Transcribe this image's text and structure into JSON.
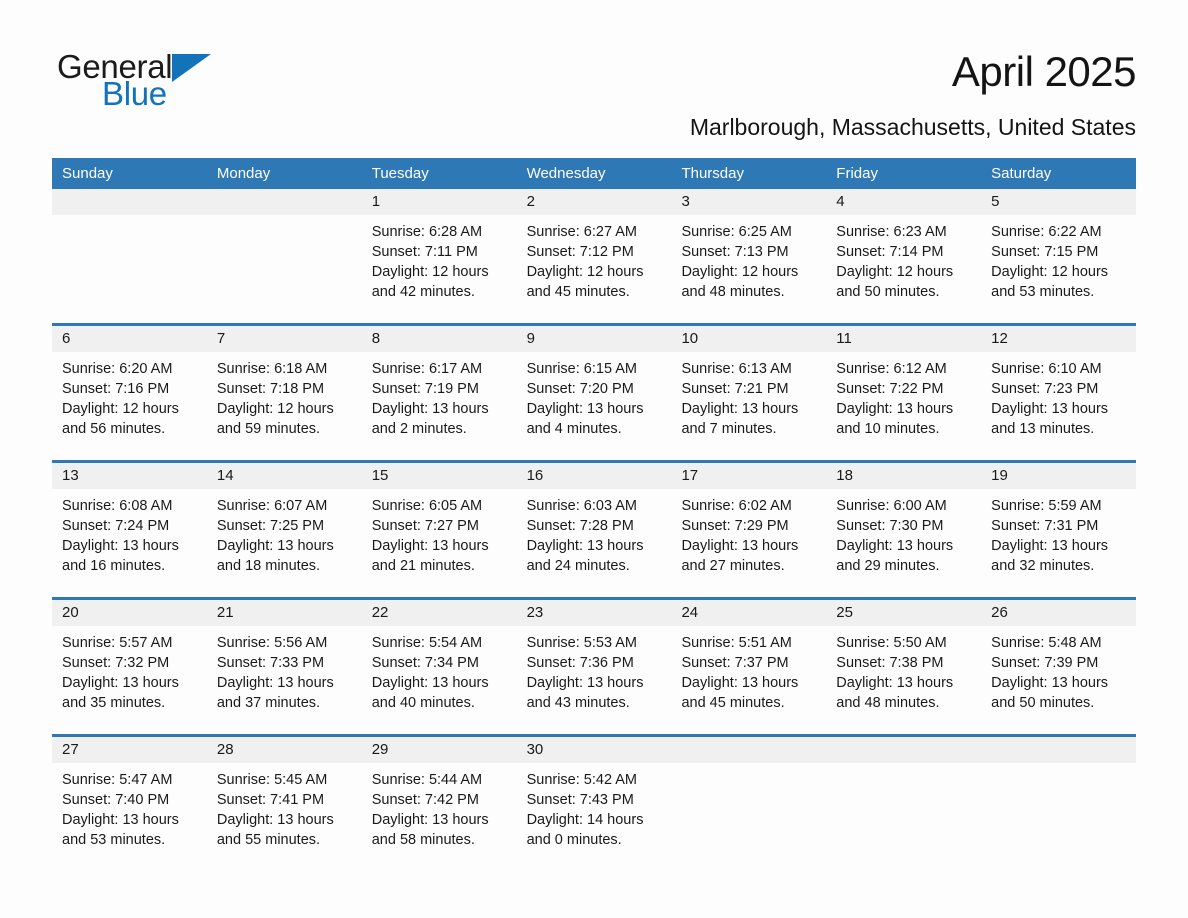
{
  "brand": {
    "name_part1": "General",
    "name_part2": "Blue",
    "accent_color": "#1273bb",
    "triangle_icon": "triangle-icon"
  },
  "header": {
    "title": "April 2025",
    "subtitle": "Marlborough, Massachusetts, United States"
  },
  "calendar": {
    "header_background": "#2f78b6",
    "daynumber_background": "#f0f0f0",
    "weekdays": [
      "Sunday",
      "Monday",
      "Tuesday",
      "Wednesday",
      "Thursday",
      "Friday",
      "Saturday"
    ],
    "weeks": [
      {
        "days": [
          {
            "number": "",
            "lines": []
          },
          {
            "number": "",
            "lines": []
          },
          {
            "number": "1",
            "lines": [
              "Sunrise: 6:28 AM",
              "Sunset: 7:11 PM",
              "Daylight: 12 hours",
              "and 42 minutes."
            ]
          },
          {
            "number": "2",
            "lines": [
              "Sunrise: 6:27 AM",
              "Sunset: 7:12 PM",
              "Daylight: 12 hours",
              "and 45 minutes."
            ]
          },
          {
            "number": "3",
            "lines": [
              "Sunrise: 6:25 AM",
              "Sunset: 7:13 PM",
              "Daylight: 12 hours",
              "and 48 minutes."
            ]
          },
          {
            "number": "4",
            "lines": [
              "Sunrise: 6:23 AM",
              "Sunset: 7:14 PM",
              "Daylight: 12 hours",
              "and 50 minutes."
            ]
          },
          {
            "number": "5",
            "lines": [
              "Sunrise: 6:22 AM",
              "Sunset: 7:15 PM",
              "Daylight: 12 hours",
              "and 53 minutes."
            ]
          }
        ]
      },
      {
        "days": [
          {
            "number": "6",
            "lines": [
              "Sunrise: 6:20 AM",
              "Sunset: 7:16 PM",
              "Daylight: 12 hours",
              "and 56 minutes."
            ]
          },
          {
            "number": "7",
            "lines": [
              "Sunrise: 6:18 AM",
              "Sunset: 7:18 PM",
              "Daylight: 12 hours",
              "and 59 minutes."
            ]
          },
          {
            "number": "8",
            "lines": [
              "Sunrise: 6:17 AM",
              "Sunset: 7:19 PM",
              "Daylight: 13 hours",
              "and 2 minutes."
            ]
          },
          {
            "number": "9",
            "lines": [
              "Sunrise: 6:15 AM",
              "Sunset: 7:20 PM",
              "Daylight: 13 hours",
              "and 4 minutes."
            ]
          },
          {
            "number": "10",
            "lines": [
              "Sunrise: 6:13 AM",
              "Sunset: 7:21 PM",
              "Daylight: 13 hours",
              "and 7 minutes."
            ]
          },
          {
            "number": "11",
            "lines": [
              "Sunrise: 6:12 AM",
              "Sunset: 7:22 PM",
              "Daylight: 13 hours",
              "and 10 minutes."
            ]
          },
          {
            "number": "12",
            "lines": [
              "Sunrise: 6:10 AM",
              "Sunset: 7:23 PM",
              "Daylight: 13 hours",
              "and 13 minutes."
            ]
          }
        ]
      },
      {
        "days": [
          {
            "number": "13",
            "lines": [
              "Sunrise: 6:08 AM",
              "Sunset: 7:24 PM",
              "Daylight: 13 hours",
              "and 16 minutes."
            ]
          },
          {
            "number": "14",
            "lines": [
              "Sunrise: 6:07 AM",
              "Sunset: 7:25 PM",
              "Daylight: 13 hours",
              "and 18 minutes."
            ]
          },
          {
            "number": "15",
            "lines": [
              "Sunrise: 6:05 AM",
              "Sunset: 7:27 PM",
              "Daylight: 13 hours",
              "and 21 minutes."
            ]
          },
          {
            "number": "16",
            "lines": [
              "Sunrise: 6:03 AM",
              "Sunset: 7:28 PM",
              "Daylight: 13 hours",
              "and 24 minutes."
            ]
          },
          {
            "number": "17",
            "lines": [
              "Sunrise: 6:02 AM",
              "Sunset: 7:29 PM",
              "Daylight: 13 hours",
              "and 27 minutes."
            ]
          },
          {
            "number": "18",
            "lines": [
              "Sunrise: 6:00 AM",
              "Sunset: 7:30 PM",
              "Daylight: 13 hours",
              "and 29 minutes."
            ]
          },
          {
            "number": "19",
            "lines": [
              "Sunrise: 5:59 AM",
              "Sunset: 7:31 PM",
              "Daylight: 13 hours",
              "and 32 minutes."
            ]
          }
        ]
      },
      {
        "days": [
          {
            "number": "20",
            "lines": [
              "Sunrise: 5:57 AM",
              "Sunset: 7:32 PM",
              "Daylight: 13 hours",
              "and 35 minutes."
            ]
          },
          {
            "number": "21",
            "lines": [
              "Sunrise: 5:56 AM",
              "Sunset: 7:33 PM",
              "Daylight: 13 hours",
              "and 37 minutes."
            ]
          },
          {
            "number": "22",
            "lines": [
              "Sunrise: 5:54 AM",
              "Sunset: 7:34 PM",
              "Daylight: 13 hours",
              "and 40 minutes."
            ]
          },
          {
            "number": "23",
            "lines": [
              "Sunrise: 5:53 AM",
              "Sunset: 7:36 PM",
              "Daylight: 13 hours",
              "and 43 minutes."
            ]
          },
          {
            "number": "24",
            "lines": [
              "Sunrise: 5:51 AM",
              "Sunset: 7:37 PM",
              "Daylight: 13 hours",
              "and 45 minutes."
            ]
          },
          {
            "number": "25",
            "lines": [
              "Sunrise: 5:50 AM",
              "Sunset: 7:38 PM",
              "Daylight: 13 hours",
              "and 48 minutes."
            ]
          },
          {
            "number": "26",
            "lines": [
              "Sunrise: 5:48 AM",
              "Sunset: 7:39 PM",
              "Daylight: 13 hours",
              "and 50 minutes."
            ]
          }
        ]
      },
      {
        "days": [
          {
            "number": "27",
            "lines": [
              "Sunrise: 5:47 AM",
              "Sunset: 7:40 PM",
              "Daylight: 13 hours",
              "and 53 minutes."
            ]
          },
          {
            "number": "28",
            "lines": [
              "Sunrise: 5:45 AM",
              "Sunset: 7:41 PM",
              "Daylight: 13 hours",
              "and 55 minutes."
            ]
          },
          {
            "number": "29",
            "lines": [
              "Sunrise: 5:44 AM",
              "Sunset: 7:42 PM",
              "Daylight: 13 hours",
              "and 58 minutes."
            ]
          },
          {
            "number": "30",
            "lines": [
              "Sunrise: 5:42 AM",
              "Sunset: 7:43 PM",
              "Daylight: 14 hours",
              "and 0 minutes."
            ]
          },
          {
            "number": "",
            "lines": []
          },
          {
            "number": "",
            "lines": []
          },
          {
            "number": "",
            "lines": []
          }
        ]
      }
    ]
  }
}
